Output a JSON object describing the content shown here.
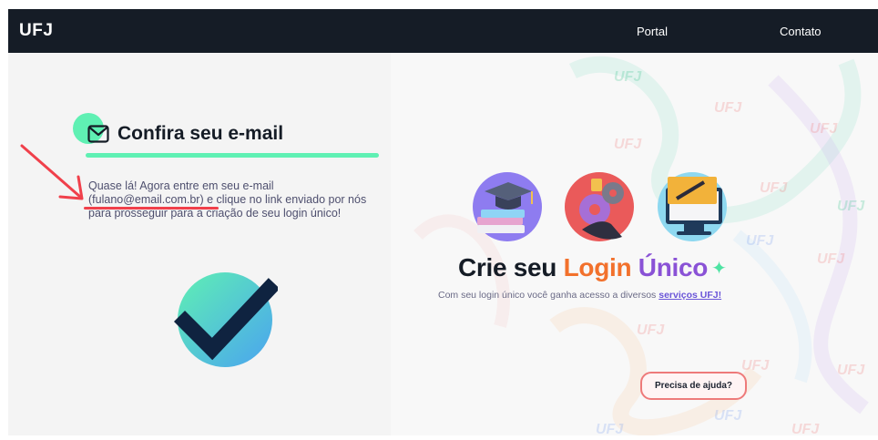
{
  "navbar": {
    "brand": "UFJ",
    "links": [
      "Portal",
      "Contato"
    ]
  },
  "confirm": {
    "title": "Confira seu e-mail",
    "instruction": "Quase lá! Agora entre em seu e-mail (fulano@email.com.br) e clique no link enviado por nós para prosseguir para a criação de seu login único!"
  },
  "promo": {
    "headline_part1": "Crie seu",
    "headline_part2": "Login",
    "headline_part3": "Único",
    "subtitle": "Com seu login único você ganha acesso a diversos",
    "subtitle_link": "serviços UFJ!",
    "help_button": "Precisa de ajuda?"
  },
  "watermark_text": "UFJ",
  "icons": [
    "mail-icon",
    "check-icon",
    "sparkle-icon",
    "graduation-books-icon",
    "gears-icon",
    "monitor-pencil-icon"
  ],
  "colors": {
    "navbar": "#151c26",
    "accent_green": "#5ff0b3",
    "accent_orange": "#f2712c",
    "accent_purple": "#8a52d6",
    "annotation_red": "#f0404b"
  }
}
